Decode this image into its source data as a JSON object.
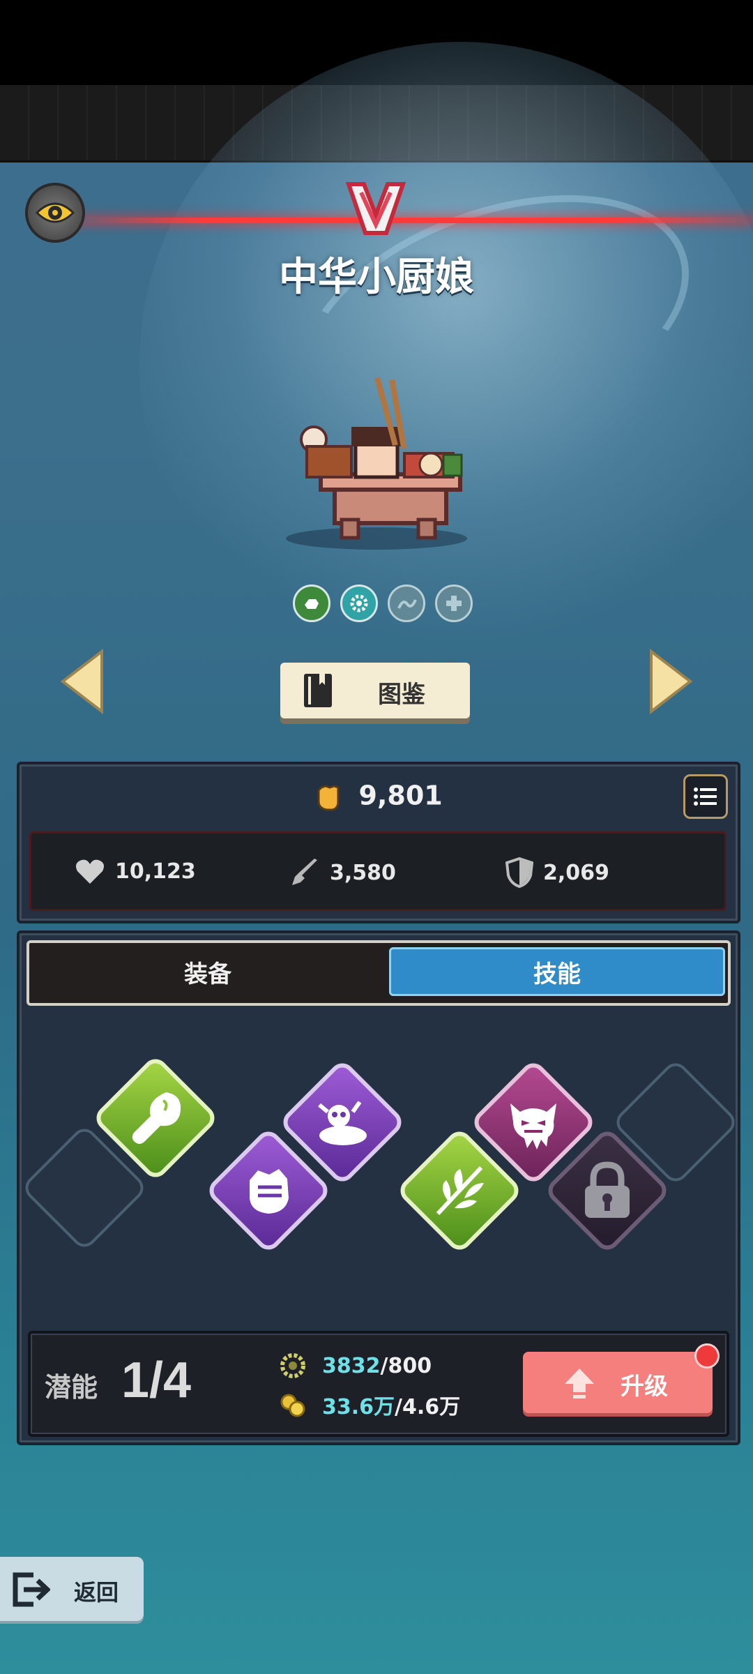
{
  "hero": {
    "name": "中华小厨娘"
  },
  "buttons": {
    "guide_label": "图鉴",
    "back_label": "返回",
    "upgrade_label": "升级"
  },
  "stats": {
    "power": "9,801",
    "health": "10,123",
    "attack": "3,580",
    "defense": "2,069"
  },
  "tabs": {
    "equipment": "装备",
    "skills": "技能",
    "active": "skills"
  },
  "potential": {
    "label": "潜能",
    "count": "1/4",
    "material_have": "3832",
    "material_need": "/800",
    "gold_have": "33.6万",
    "gold_need": "/4.6万"
  },
  "colors": {
    "accent_blue": "#2f8cc8",
    "upgrade_red": "#f47f7d",
    "cyan_value": "#6ee0e8"
  },
  "skills": [
    {
      "icon": "drumstick-icon",
      "style": "green",
      "locked": false
    },
    {
      "icon": "fist-icon",
      "style": "purple",
      "locked": false
    },
    {
      "icon": "skull-poison-icon",
      "style": "purple",
      "locked": false
    },
    {
      "icon": "leaf-icon",
      "style": "green",
      "locked": false
    },
    {
      "icon": "demon-face-icon",
      "style": "magenta",
      "locked": false
    },
    {
      "icon": "lock-icon",
      "style": "dark",
      "locked": true
    }
  ]
}
